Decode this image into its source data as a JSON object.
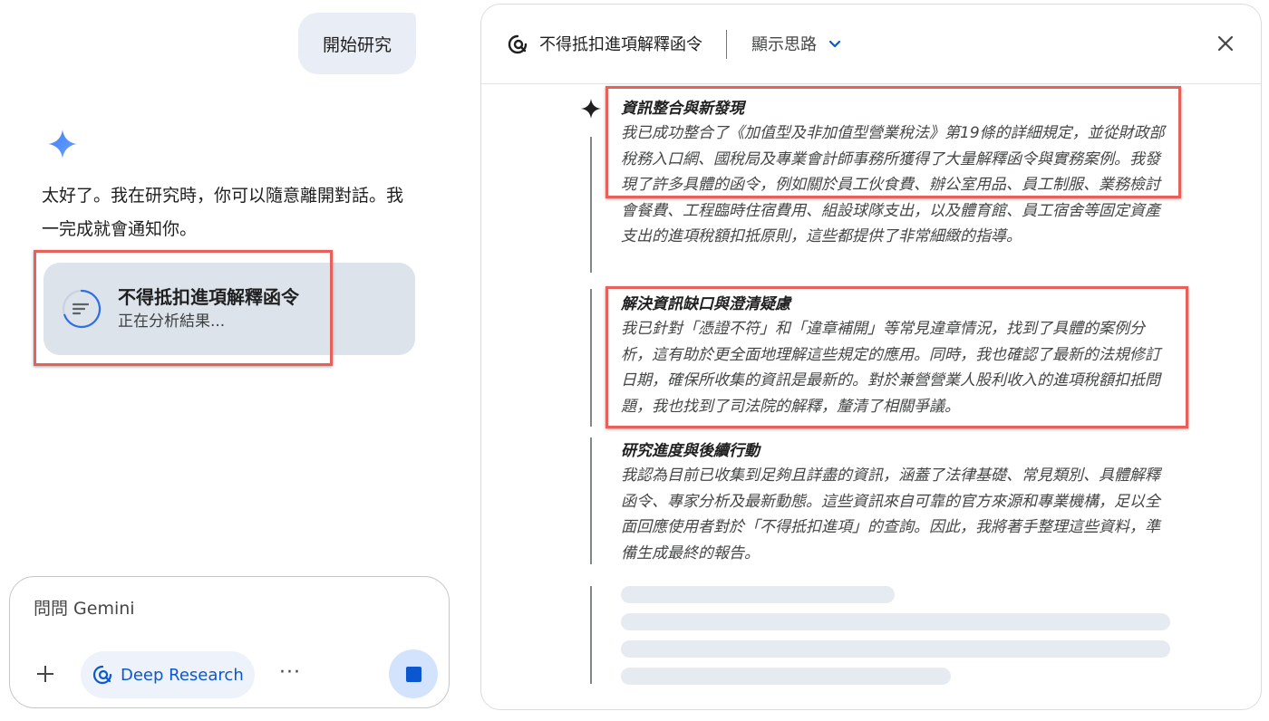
{
  "chat": {
    "user_message": "開始研究",
    "assistant_reply": "太好了。我在研究時，你可以隨意離開對話。我一完成就會通知你。",
    "task_card": {
      "title": "不得抵扣進項解釋函令",
      "status": "正在分析結果..."
    }
  },
  "composer": {
    "placeholder": "問問 Gemini",
    "deep_research_label": "Deep Research",
    "more_label": "···"
  },
  "panel": {
    "title": "不得抵扣進項解釋函令",
    "thoughts_toggle": "顯示思路",
    "close_label": "✕",
    "sections": [
      {
        "title": "資訊整合與新發現",
        "body": "我已成功整合了《加值型及非加值型營業稅法》第19條的詳細規定，並從財政部稅務入口網、國稅局及專業會計師事務所獲得了大量解釋函令與實務案例。我發現了許多具體的函令，例如關於員工伙食費、辦公室用品、員工制服、業務檢討會餐費、工程臨時住宿費用、組設球隊支出，以及體育館、員工宿舍等固定資產支出的進項稅額扣抵原則，這些都提供了非常細緻的指導。"
      },
      {
        "title": "解決資訊缺口與澄清疑慮",
        "body": "我已針對「憑證不符」和「違章補開」等常見違章情況，找到了具體的案例分析，這有助於更全面地理解這些規定的應用。同時，我也確認了最新的法規修訂日期，確保所收集的資訊是最新的。對於兼營營業人股利收入的進項稅額扣抵問題，我也找到了司法院的解釋，釐清了相關爭議。"
      },
      {
        "title": "研究進度與後續行動",
        "body": "我認為目前已收集到足夠且詳盡的資訊，涵蓋了法律基礎、常見類別、具體解釋函令、專家分析及最新動態。這些資訊來自可靠的官方來源和專業機構，足以全面回應使用者對於「不得抵扣進項」的查詢。因此，我將著手整理這些資料，準備生成最終的報告。"
      }
    ]
  },
  "colors": {
    "accent_blue": "#0b57d0",
    "highlight_red": "#e8605a",
    "gemini_spark": "#4285f4"
  },
  "icons": [
    "gemini-spark-icon",
    "research-task-icon",
    "deep-research-icon",
    "plus-icon",
    "stop-icon",
    "chevron-down-icon",
    "close-icon"
  ]
}
